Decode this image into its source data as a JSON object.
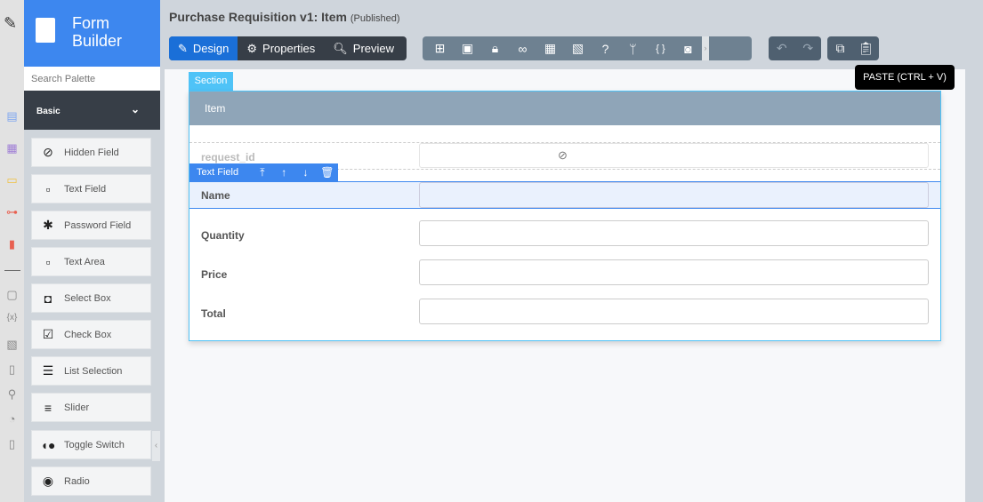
{
  "header": {
    "title": "Purchase Requisition v1: Item",
    "status": "(Published)"
  },
  "brand": {
    "title_line1": "Form",
    "title_line2": "Builder"
  },
  "palette": {
    "search_placeholder": "Search Palette",
    "category": "Basic",
    "items": [
      {
        "label": "Hidden Field",
        "icon": "eye-slash-icon"
      },
      {
        "label": "Text Field",
        "icon": "text-field-icon"
      },
      {
        "label": "Password Field",
        "icon": "asterisk-icon"
      },
      {
        "label": "Text Area",
        "icon": "text-area-icon"
      },
      {
        "label": "Select Box",
        "icon": "select-box-icon"
      },
      {
        "label": "Check Box",
        "icon": "checkbox-icon"
      },
      {
        "label": "List Selection",
        "icon": "list-icon"
      },
      {
        "label": "Slider",
        "icon": "sliders-icon"
      },
      {
        "label": "Toggle Switch",
        "icon": "toggle-icon"
      },
      {
        "label": "Radio",
        "icon": "radio-icon"
      }
    ]
  },
  "tabs": {
    "design": "Design",
    "properties": "Properties",
    "preview": "Preview"
  },
  "tooltip": "PASTE (CTRL + V)",
  "form": {
    "section_tab": "Section",
    "section_title": "Item",
    "field_toolbar_label": "Text Field",
    "fields": [
      {
        "label": "request_id"
      },
      {
        "label": "Name"
      },
      {
        "label": "Quantity"
      },
      {
        "label": "Price"
      },
      {
        "label": "Total"
      }
    ]
  },
  "colors": {
    "primary": "#3d87ef",
    "section": "#4fc3f7",
    "dark": "#373e47"
  }
}
